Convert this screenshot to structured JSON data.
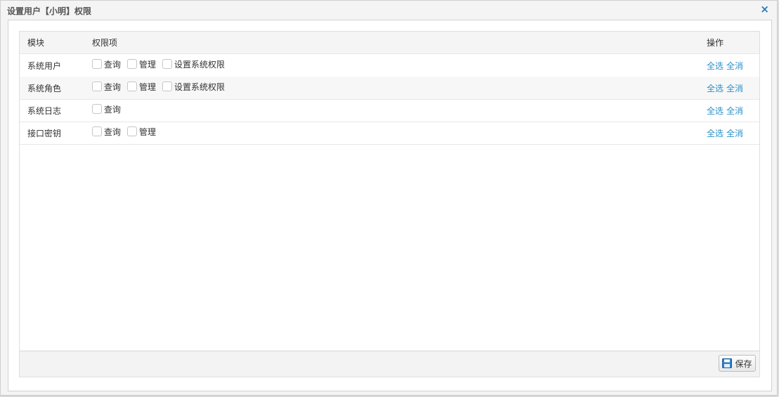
{
  "dialog": {
    "title": "设置用户【小明】权限",
    "close_label": "×"
  },
  "table": {
    "headers": {
      "module": "模块",
      "permissions": "权限项",
      "operations": "操作"
    },
    "rows": [
      {
        "module": "系统用户",
        "permissions": [
          "查询",
          "管理",
          "设置系统权限"
        ]
      },
      {
        "module": "系统角色",
        "permissions": [
          "查询",
          "管理",
          "设置系统权限"
        ]
      },
      {
        "module": "系统日志",
        "permissions": [
          "查询"
        ]
      },
      {
        "module": "接口密钥",
        "permissions": [
          "查询",
          "管理"
        ]
      }
    ],
    "select_all_label": "全选",
    "clear_all_label": "全消"
  },
  "footer": {
    "save_label": "保存",
    "save_icon": "save-icon"
  },
  "colors": {
    "link": "#2a8fc9",
    "close": "#2a7ab8",
    "header_bg": "#f5f5f5"
  }
}
